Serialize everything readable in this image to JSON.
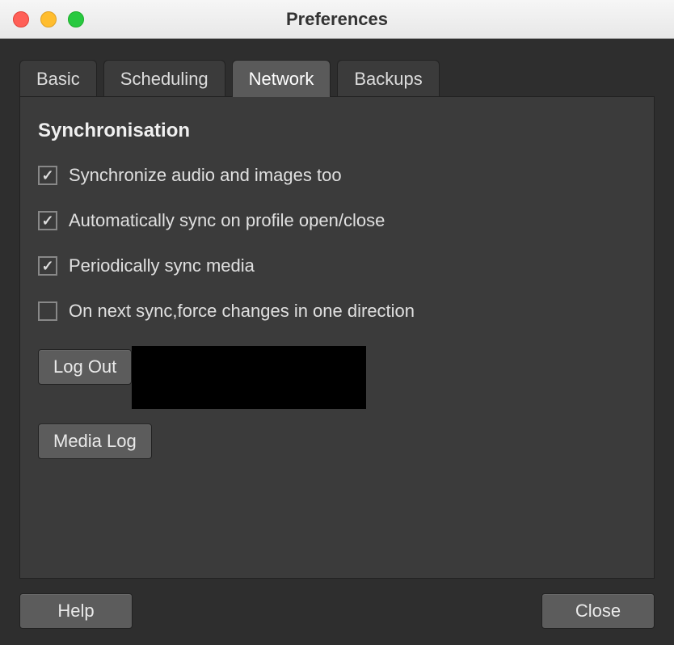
{
  "window": {
    "title": "Preferences"
  },
  "tabs": {
    "basic": "Basic",
    "scheduling": "Scheduling",
    "network": "Network",
    "backups": "Backups",
    "active": "network"
  },
  "network": {
    "section_title": "Synchronisation",
    "checkboxes": {
      "sync_media": {
        "label": "Synchronize audio and images too",
        "checked": true
      },
      "auto_sync": {
        "label": "Automatically sync on profile open/close",
        "checked": true
      },
      "periodic_sync": {
        "label": "Periodically sync media",
        "checked": true
      },
      "force_direction": {
        "label": "On next sync,force changes in one direction",
        "checked": false
      }
    },
    "buttons": {
      "logout": "Log Out",
      "media_log": "Media Log"
    }
  },
  "footer": {
    "help": "Help",
    "close": "Close"
  }
}
